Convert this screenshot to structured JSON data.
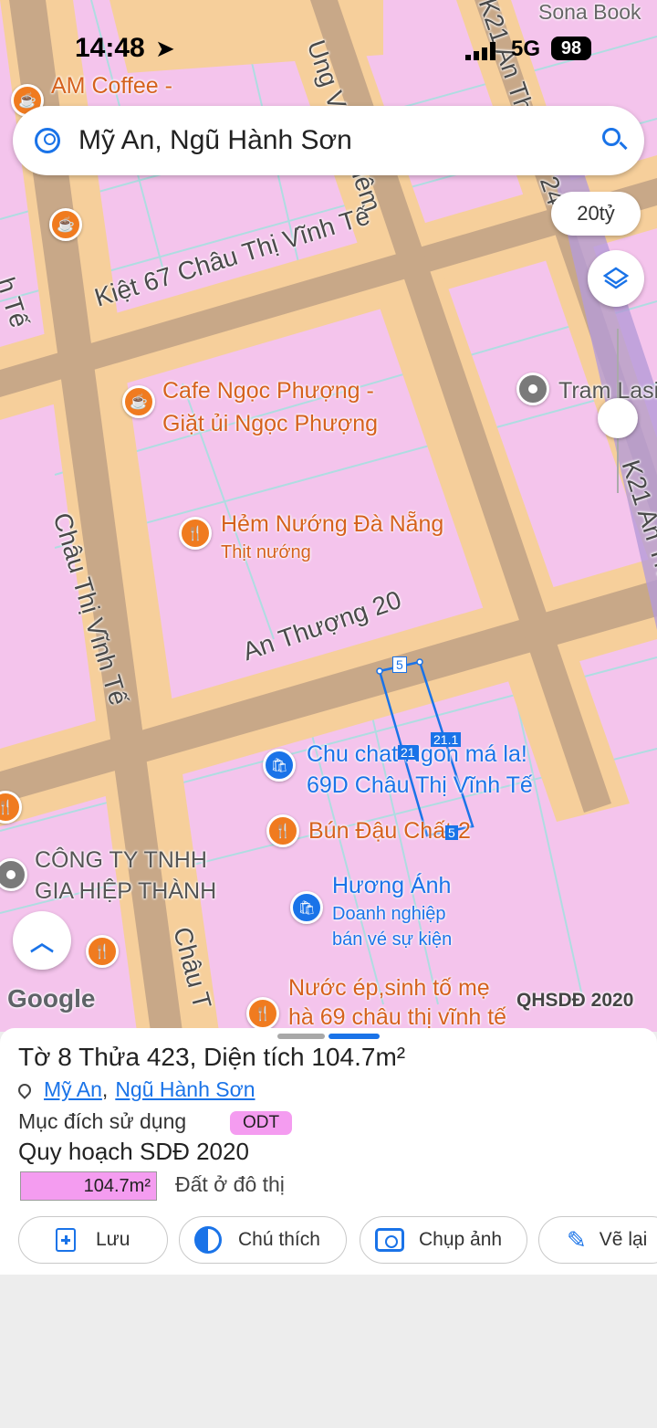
{
  "status_bar": {
    "time": "14:48",
    "network": "5G",
    "battery": "98"
  },
  "search": {
    "query": "Mỹ An, Ngũ Hành Sơn",
    "account_icon": "account-circle-icon",
    "search_icon": "search-icon"
  },
  "map": {
    "scale_label": "20tỷ",
    "watermark": "Google",
    "overlay_label": "QHSDĐ 2020",
    "streets": {
      "kiet67": "Kiệt 67 Châu Thị Vĩnh Tế",
      "ung_van_khiem": "Ung Văn Khiêm",
      "chau_thi_vinh_te_left": "Châu Thị Vĩnh Tế",
      "an_thuong20": "An Thượng 20",
      "chau_thi_bottom": "Châu T",
      "k21_top": "K21 An Thượng 24",
      "k21_right": "K21 An Th",
      "left_edge": "h Tế"
    },
    "pois": {
      "am_coffee": "AM Coffee -",
      "sona_book": "Sona Book",
      "cafe_ngoc_phuong_1": "Cafe Ngọc Phượng -",
      "cafe_ngoc_phuong_2": "Giặt ủi Ngọc Phượng",
      "hem_nuong": "Hẻm Nướng Đà Nẵng",
      "hem_nuong_sub": "Thịt nướng",
      "tram_lasi": "Tram Lasi",
      "chu_chat_1": "Chu chat Ngon má la!",
      "chu_chat_2": "69D Châu Thị Vĩnh Tế",
      "bun_dau": "Bún Đậu Chất 2",
      "cong_ty_1": "CÔNG TY TNHH",
      "cong_ty_2": "GIA HIỆP THÀNH",
      "huong_anh": "Hương Ánh",
      "huong_anh_sub1": "Doanh nghiệp",
      "huong_anh_sub2": "bán vé sự kiện",
      "nuoc_ep_1": "Nước ép,sinh tố mẹ",
      "nuoc_ep_2": "hà 69 châu thị vĩnh tế"
    },
    "parcel_dims": {
      "top": "5",
      "left": "21",
      "right": "21.1",
      "bottom": "5"
    }
  },
  "parcel": {
    "title": "Tờ 8 Thửa 423, Diện tích 104.7m²",
    "location_ward": "Mỹ An",
    "location_sep": ",",
    "location_district": "Ngũ Hành Sơn",
    "purpose_label": "Mục đích sử dụng",
    "purpose_code": "ODT",
    "plan_title": "Quy hoạch SDĐ 2020",
    "plan_area": "104.7m²",
    "plan_desc": "Đất ở đô thị",
    "colors": {
      "odt": "#f49cf0",
      "accent": "#1a73e8"
    }
  },
  "actions": [
    {
      "label": "Lưu",
      "icon": "add-note-icon"
    },
    {
      "label": "Chú thích",
      "icon": "half-circle-icon"
    },
    {
      "label": "Chụp ảnh",
      "icon": "add-photo-icon"
    },
    {
      "label": "Vẽ lại",
      "icon": "draw-icon"
    }
  ]
}
